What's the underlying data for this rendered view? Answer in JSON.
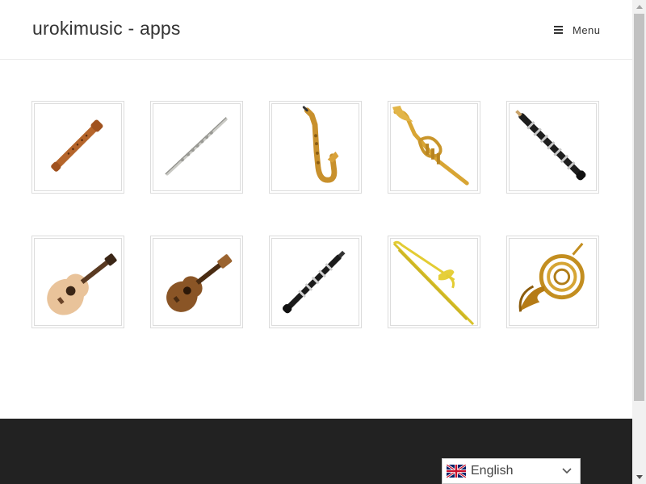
{
  "header": {
    "site_title": "urokimusic - apps",
    "menu_label": "Menu"
  },
  "gallery": {
    "items": [
      {
        "icon": "recorder-icon"
      },
      {
        "icon": "flute-icon"
      },
      {
        "icon": "saxophone-icon"
      },
      {
        "icon": "trumpet-icon"
      },
      {
        "icon": "oboe-icon"
      },
      {
        "icon": "acoustic-guitar-icon"
      },
      {
        "icon": "ukulele-icon"
      },
      {
        "icon": "clarinet-icon"
      },
      {
        "icon": "trombone-icon"
      },
      {
        "icon": "french-horn-icon"
      }
    ]
  },
  "footer": {
    "language_selector": {
      "selected": "English",
      "flag_icon": "uk-flag-icon"
    }
  },
  "colors": {
    "footer_bg": "#222222",
    "title_text": "#333333",
    "tile_border": "#dcdcdc"
  }
}
